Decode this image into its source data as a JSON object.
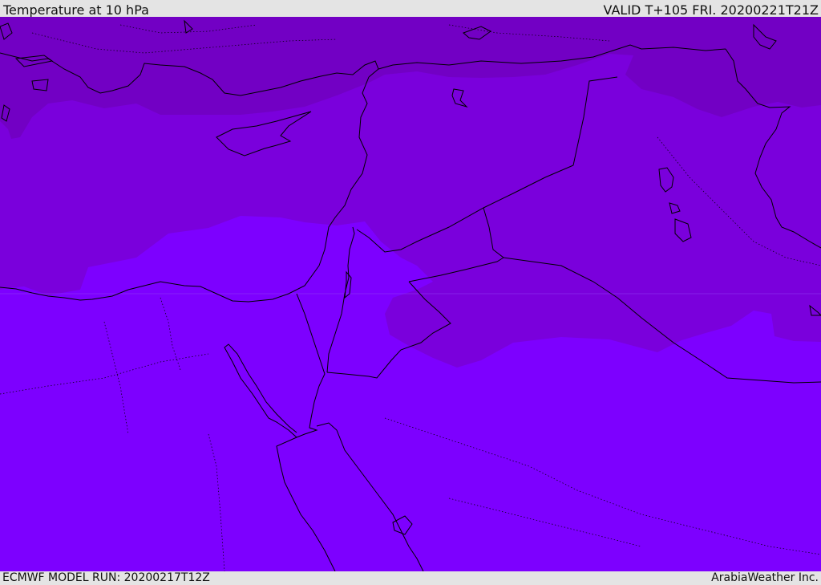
{
  "header": {
    "title": "Temperature at 10 hPa",
    "valid": "VALID T+105 FRI. 20200221T21Z"
  },
  "footer": {
    "model_run": "ECMWF MODEL RUN: 20200217T12Z",
    "credit": "ArabiaWeather Inc."
  },
  "colors": {
    "band_warm": "#7200c4",
    "band_mid": "#7a00dc",
    "band_cool": "#7d00ff",
    "coastline": "#000000"
  }
}
